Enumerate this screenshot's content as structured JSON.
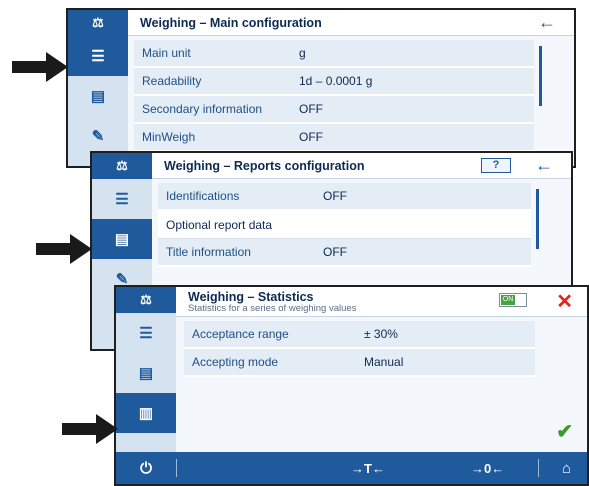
{
  "screen_main": {
    "title": "Weighing – Main configuration",
    "rows": [
      {
        "label": "Main unit",
        "value": "g"
      },
      {
        "label": "Readability",
        "value": "1d – 0.0001 g"
      },
      {
        "label": "Secondary information",
        "value": "OFF"
      },
      {
        "label": "MinWeigh",
        "value": "OFF"
      }
    ]
  },
  "screen_reports": {
    "title": "Weighing – Reports configuration",
    "help_label": "?",
    "rows": [
      {
        "label": "Identifications",
        "value": "OFF"
      },
      {
        "label": "Optional report data",
        "value": ""
      },
      {
        "label": "Title information",
        "value": "OFF"
      }
    ]
  },
  "screen_stats": {
    "title": "Weighing – Statistics",
    "subtitle": "Statistics for a series of weighing values",
    "toggle_label": "ON",
    "rows": [
      {
        "label": "Acceptance range",
        "value": "± 30%"
      },
      {
        "label": "Accepting mode",
        "value": "Manual"
      }
    ],
    "footer": {
      "tare": "→T←",
      "zero": "→0←"
    }
  },
  "colors": {
    "brand_blue": "#1f5a9c",
    "cancel_red": "#e2231a",
    "confirm_green": "#3a9b28",
    "arrow_black": "#1a1a1a"
  }
}
